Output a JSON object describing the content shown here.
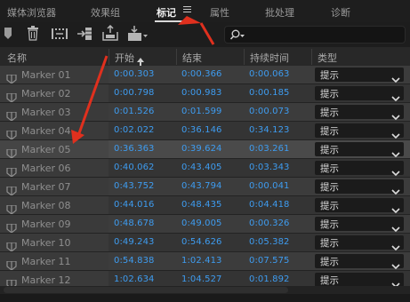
{
  "tabs": [
    {
      "label": "媒体浏览器"
    },
    {
      "label": "效果组"
    },
    {
      "label": "标记"
    },
    {
      "label": "属性"
    },
    {
      "label": "批处理"
    },
    {
      "label": "诊断"
    }
  ],
  "search": {
    "placeholder": ""
  },
  "columns": {
    "name": "名称",
    "start": "开始",
    "end": "结束",
    "duration": "持续时间",
    "type": "类型"
  },
  "rows": [
    {
      "name": "Marker 01",
      "start": "0:00.303",
      "end": "0:00.366",
      "duration": "0:00.063",
      "type": "提示"
    },
    {
      "name": "Marker 02",
      "start": "0:00.798",
      "end": "0:00.983",
      "duration": "0:00.185",
      "type": "提示"
    },
    {
      "name": "Marker 03",
      "start": "0:01.526",
      "end": "0:01.599",
      "duration": "0:00.073",
      "type": "提示"
    },
    {
      "name": "Marker 04",
      "start": "0:02.022",
      "end": "0:36.146",
      "duration": "0:34.123",
      "type": "提示"
    },
    {
      "name": "Marker 05",
      "start": "0:36.363",
      "end": "0:39.624",
      "duration": "0:03.261",
      "type": "提示"
    },
    {
      "name": "Marker 06",
      "start": "0:40.062",
      "end": "0:43.405",
      "duration": "0:03.343",
      "type": "提示"
    },
    {
      "name": "Marker 07",
      "start": "0:43.752",
      "end": "0:43.794",
      "duration": "0:00.041",
      "type": "提示"
    },
    {
      "name": "Marker 08",
      "start": "0:44.016",
      "end": "0:48.435",
      "duration": "0:04.418",
      "type": "提示"
    },
    {
      "name": "Marker 09",
      "start": "0:48.678",
      "end": "0:49.005",
      "duration": "0:00.326",
      "type": "提示"
    },
    {
      "name": "Marker 10",
      "start": "0:49.243",
      "end": "0:54.626",
      "duration": "0:05.382",
      "type": "提示"
    },
    {
      "name": "Marker 11",
      "start": "0:54.838",
      "end": "1:02.413",
      "duration": "0:07.575",
      "type": "提示"
    },
    {
      "name": "Marker 12",
      "start": "1:02.634",
      "end": "1:04.527",
      "duration": "0:01.892",
      "type": "提示"
    }
  ],
  "colors": {
    "timecode": "#3e9cf0",
    "annotation": "#e0301e",
    "active_tab": "#f0f0f0"
  },
  "icons": [
    "marker-flag-icon",
    "delete-icon",
    "insert-marker-icon",
    "export-icon",
    "import-icon",
    "dropdown-tool-icon",
    "search-icon",
    "menu-icon",
    "sort-up-icon",
    "chevron-down-icon"
  ]
}
